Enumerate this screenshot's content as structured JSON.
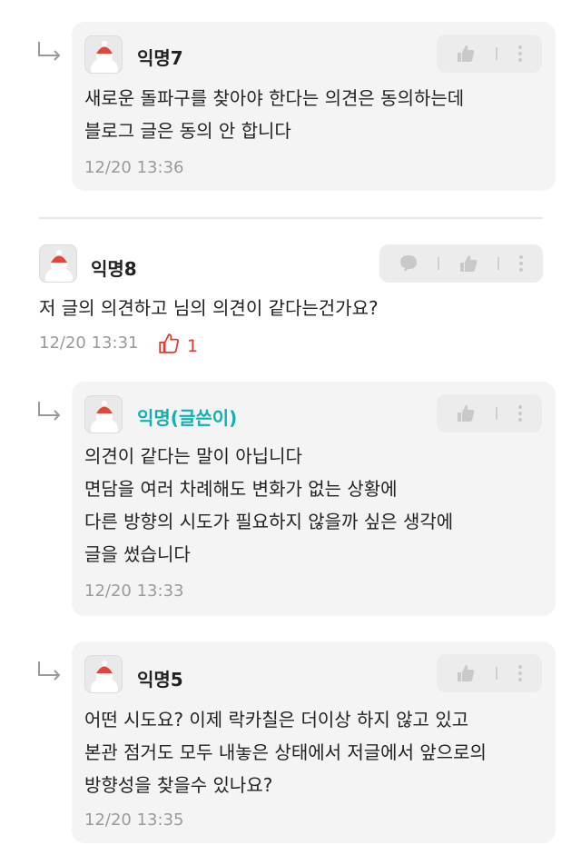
{
  "comments": [
    {
      "nickname": "익명7",
      "lines": [
        "새로운 돌파구를 찾아야 한다는 의견은 동의하는데",
        "블로그 글은 동의 안 합니다"
      ],
      "timestamp": "12/20 13:36"
    },
    {
      "nickname": "익명8",
      "lines": [
        "저 글의 의견하고 님의 의견이 같다는건가요?"
      ],
      "timestamp": "12/20 13:31",
      "likes": "1"
    },
    {
      "nickname": "익명(글쓴이)",
      "lines": [
        "의견이 같다는 말이 아닙니다",
        "면담을 여러 차례해도 변화가 없는 상황에",
        "다른 방향의 시도가 필요하지 않을까 싶은 생각에",
        "글을 썼습니다"
      ],
      "timestamp": "12/20 13:33"
    },
    {
      "nickname": "익명5",
      "lines": [
        "어떤 시도요? 이제 락카칠은 더이상 하지 않고 있고",
        "본관 점거도 모두 내놓은 상태에서 저글에서 앞으로의",
        "방향성을 찾을수 있나요?"
      ],
      "timestamp": "12/20 13:35"
    }
  ],
  "colors": {
    "author": "#12b0b0",
    "like": "#e0392f",
    "bubble": "#f4f4f4"
  },
  "icons": [
    "reply-arrow-icon",
    "thumbs-up-icon",
    "more-vertical-icon",
    "speech-bubble-icon"
  ]
}
